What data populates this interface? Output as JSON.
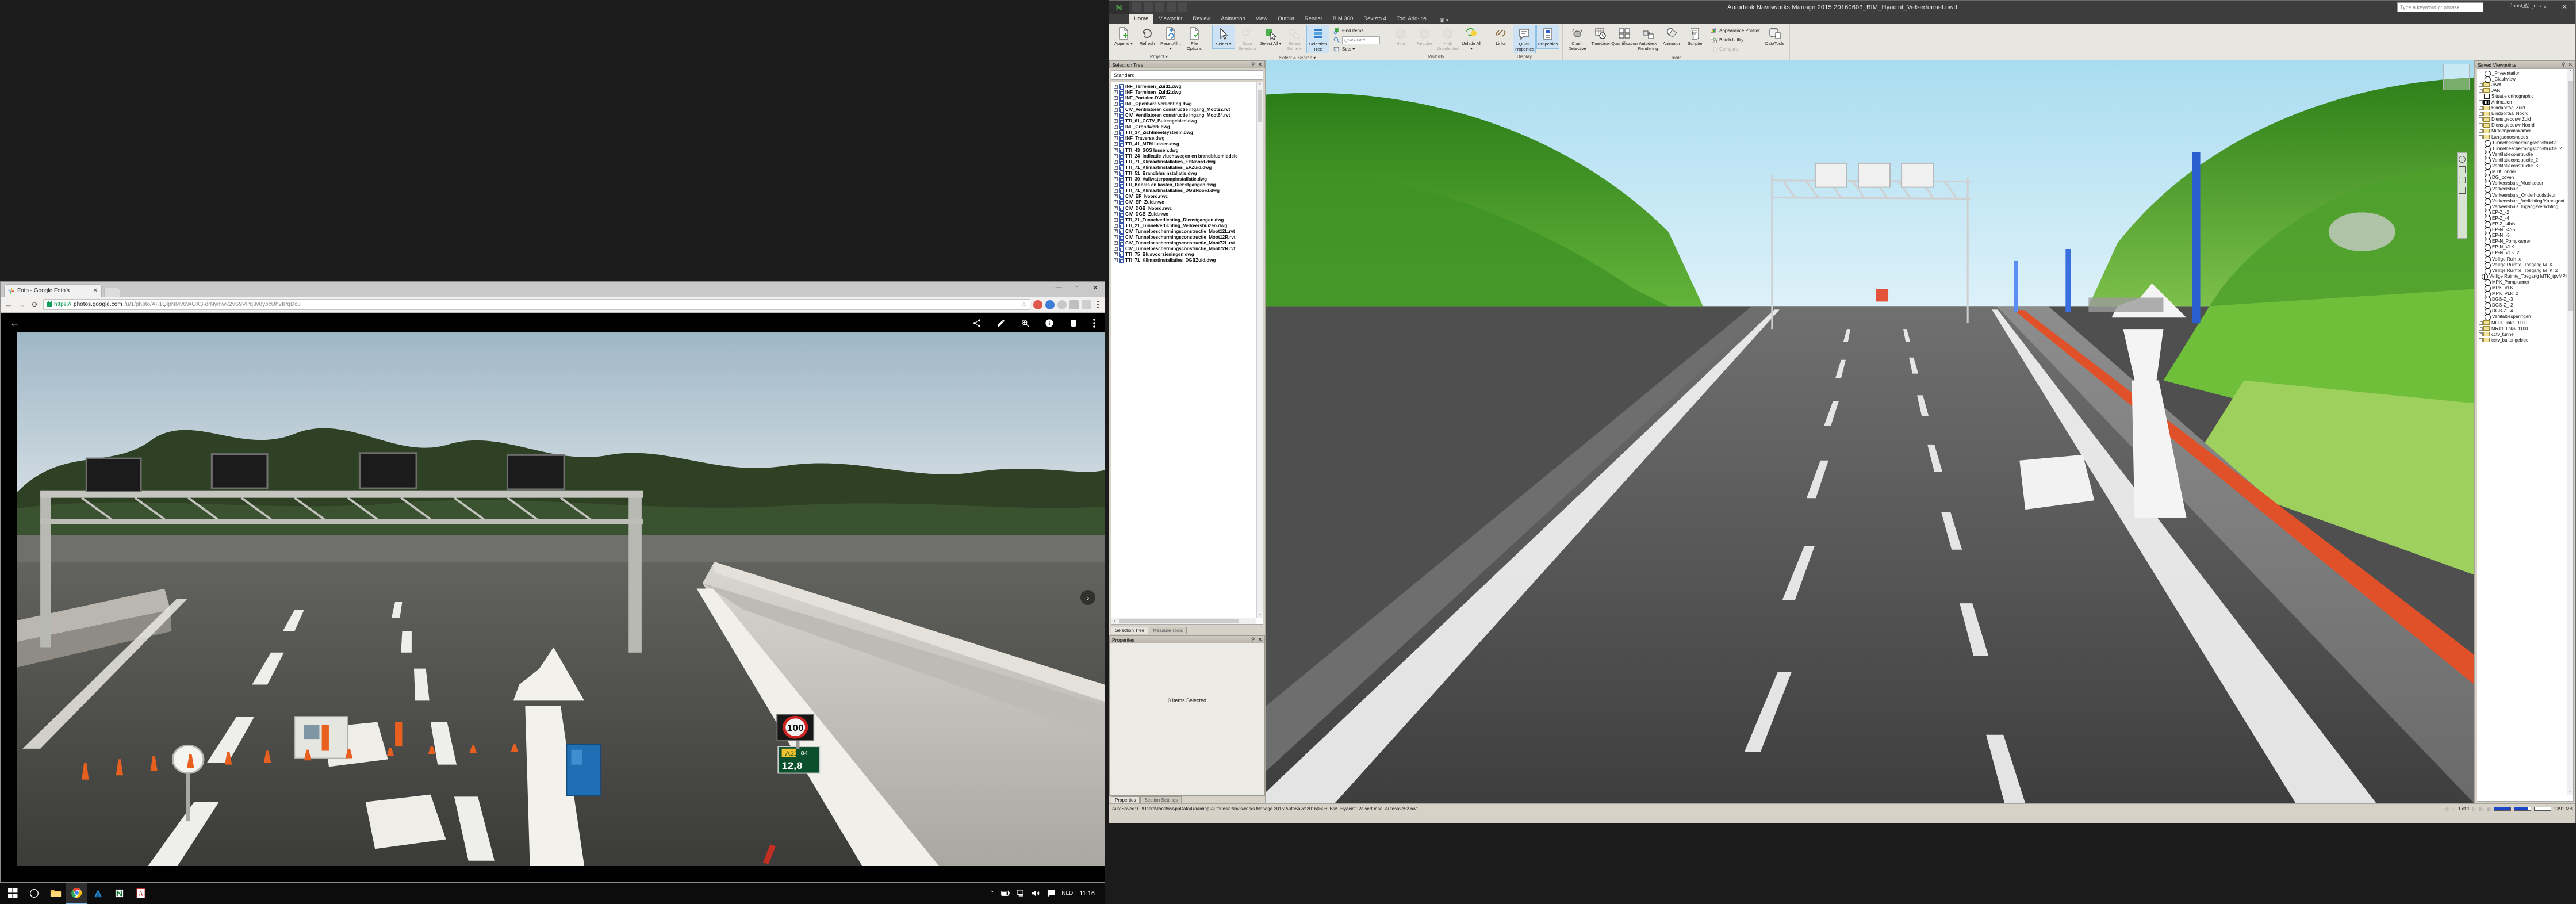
{
  "navisworks": {
    "title": "Autodesk Navisworks Manage 2015    20160603_BIM_Hyacint_Velsertunnel.nwd",
    "search_placeholder": "Type a keyword or phrase",
    "account": "Joost Weijers",
    "window_buttons": [
      "—",
      "▫",
      "✕"
    ],
    "tabs": [
      {
        "label": "Home",
        "active": true
      },
      {
        "label": "Viewpoint",
        "active": false
      },
      {
        "label": "Review",
        "active": false
      },
      {
        "label": "Animation",
        "active": false
      },
      {
        "label": "View",
        "active": false
      },
      {
        "label": "Output",
        "active": false
      },
      {
        "label": "Render",
        "active": false
      },
      {
        "label": "BIM 360",
        "active": false
      },
      {
        "label": "Revizto 4",
        "active": false
      },
      {
        "label": "Tool Add-ins",
        "active": false
      }
    ],
    "ribbon_groups": [
      {
        "name": "Project",
        "buttons": [
          {
            "label": "Append",
            "icon": "append-icon",
            "state": "normal",
            "dropdown": true
          },
          {
            "label": "Refresh",
            "icon": "refresh-icon",
            "state": "normal"
          },
          {
            "label": "Reset All...",
            "icon": "reset-all-icon",
            "state": "normal",
            "dropdown": true
          },
          {
            "label": "File Options",
            "icon": "file-options-icon",
            "state": "normal"
          }
        ]
      },
      {
        "name": "Select & Search",
        "buttons": [
          {
            "label": "Select",
            "icon": "cursor-icon",
            "state": "selected",
            "dropdown": true
          },
          {
            "label": "Save Selection",
            "icon": "save-selection-icon",
            "state": "disabled"
          },
          {
            "label": "Select All",
            "icon": "select-all-icon",
            "state": "normal",
            "dropdown": true
          },
          {
            "label": "Select Same",
            "icon": "select-same-icon",
            "state": "disabled",
            "dropdown": true
          },
          {
            "label": "Selection Tree",
            "icon": "selection-tree-icon",
            "state": "selected"
          }
        ],
        "small_items": [
          {
            "label": "Find Items",
            "icon": "find-items-icon"
          },
          {
            "label": "Quick Find",
            "icon": "quick-find-icon",
            "is_input": true
          },
          {
            "label": "Sets",
            "icon": "sets-icon",
            "dropdown": true
          }
        ]
      },
      {
        "name": "Visibility",
        "buttons": [
          {
            "label": "Hide",
            "icon": "hide-icon",
            "state": "disabled"
          },
          {
            "label": "Require",
            "icon": "require-icon",
            "state": "disabled"
          },
          {
            "label": "Hide Unselected",
            "icon": "hide-unselected-icon",
            "state": "disabled"
          },
          {
            "label": "Unhide All",
            "icon": "unhide-all-icon",
            "state": "normal",
            "dropdown": true
          }
        ]
      },
      {
        "name": "Display",
        "buttons": [
          {
            "label": "Links",
            "icon": "links-icon",
            "state": "normal"
          },
          {
            "label": "Quick Properties",
            "icon": "quick-properties-icon",
            "state": "selected"
          },
          {
            "label": "Properties",
            "icon": "properties-icon",
            "state": "selected"
          }
        ]
      },
      {
        "name": "Tools",
        "buttons": [
          {
            "label": "Clash Detective",
            "icon": "clash-detective-icon",
            "state": "normal"
          },
          {
            "label": "TimeLiner",
            "icon": "timeliner-icon",
            "state": "normal"
          },
          {
            "label": "Quantification",
            "icon": "quantification-icon",
            "state": "normal"
          },
          {
            "label": "Autodesk Rendering",
            "icon": "autodesk-rendering-icon",
            "state": "normal"
          },
          {
            "label": "Animator",
            "icon": "animator-icon",
            "state": "normal"
          },
          {
            "label": "Scripter",
            "icon": "scripter-icon",
            "state": "normal"
          }
        ],
        "small_items": [
          {
            "label": "Appearance Profiler",
            "icon": "appearance-profiler-icon"
          },
          {
            "label": "Batch Utility",
            "icon": "batch-utility-icon"
          },
          {
            "label": "Compare",
            "icon": "compare-icon",
            "disabled": true
          }
        ],
        "extra_buttons": [
          {
            "label": "DataTools",
            "icon": "datatools-icon",
            "state": "normal"
          }
        ]
      }
    ],
    "selection_tree": {
      "title": "Selection Tree",
      "standard_value": "Standard",
      "items": [
        "INF_Terreinen_Zuid1.dwg",
        "INF_Terreinen_Zuid2.dwg",
        "INF_Portalen.DWG",
        "INF_Openbare verlichting.dwg",
        "CIV_Ventilatoren constructie ingang_Moot22.rvt",
        "CIV_Ventilatoren constructie ingang_Moot64.rvt",
        "TTI_61_CCTV_Buitengebied.dwg",
        "INF_Grondwerk.dwg",
        "TTI_37_Zichtmeetsysteem.dwg",
        "INF_Traverse.dwg",
        "TTI_41_MTM lussen.dwg",
        "TTI_43_SOS lussen.dwg",
        "TTI_24_Indicatie vluchtwegen en brandblusmiddele",
        "TTI_71_Klimaatinstallaties_EPNoord.dwg",
        "TTI_71_Klimaatinstallaties_EPZuid.dwg",
        "TTI_51_Brandblusinstallatie.dwg",
        "TTI_30_Vuilwaterpompinstallatie.dwg",
        "TTI_Kabels en kasten_Dienstgangen.dwg",
        "TTI_71_Klimaatinstallaties_DGBNoord.dwg",
        "CIV_EP_Noord.nwc",
        "CIV_EP_Zuid.nwc",
        "CIV_DGB_Noord.nwc",
        "CIV_DGB_Zuid.nwc",
        "TTI_21_Tunnelverlichting_Dienstgangen.dwg",
        "TTI_21_Tunnelverlichting_Verkeersbuizen.dwg",
        "CIV_Tunnelbeschermingsconstructie_Moot12L.rvt",
        "CIV_Tunnelbeschermingsconstructie_Moot12R.rvt",
        "CIV_Tunnelbeschermingsconstructie_Moot72L.rvt",
        "CIV_Tunnelbeschermingsconstructie_Moot72R.rvt",
        "TTI_75_Blusvoorzieningen.dwg",
        "TTI_71_Klimaatinstallaties_DGBZuid.dwg"
      ],
      "dock_tabs": [
        {
          "label": "Selection Tree",
          "active": true
        },
        {
          "label": "Measure Tools",
          "active": false
        }
      ]
    },
    "properties": {
      "title": "Properties",
      "empty_message": "0 Items Selected",
      "dock_tabs": [
        {
          "label": "Properties",
          "active": true
        },
        {
          "label": "Section Settings",
          "active": false
        }
      ]
    },
    "saved_viewpoints": {
      "title": "Saved Viewpoints",
      "items": [
        {
          "label": "_Presentation",
          "icon": "camera-icon",
          "expandable": false
        },
        {
          "label": "_Clashview",
          "icon": "camera-icon",
          "expandable": false
        },
        {
          "label": "JAW",
          "icon": "folder-icon",
          "expandable": true
        },
        {
          "label": "JAN",
          "icon": "folder-icon",
          "expandable": true
        },
        {
          "label": "Situatie orthographic",
          "icon": "cube-icon",
          "expandable": false
        },
        {
          "label": "Animation",
          "icon": "film-icon",
          "expandable": true
        },
        {
          "label": "Eindportaal Zuid",
          "icon": "folder-icon",
          "expandable": true
        },
        {
          "label": "Eindportaal Noord",
          "icon": "folder-icon",
          "expandable": true
        },
        {
          "label": "Dienstgebouw Zuid",
          "icon": "folder-icon",
          "expandable": true
        },
        {
          "label": "Dienstgebouw Noord",
          "icon": "folder-icon",
          "expandable": true
        },
        {
          "label": "Middenpompkamer",
          "icon": "folder-icon",
          "expandable": true
        },
        {
          "label": "Langsdoorsnedes",
          "icon": "folder-icon",
          "expandable": true
        },
        {
          "label": "Tunnelbeschermingsconstructie",
          "icon": "camera-icon",
          "expandable": false
        },
        {
          "label": "Tunnelbeschermingsconstructie_2",
          "icon": "camera-icon",
          "expandable": false
        },
        {
          "label": "Ventilatieconstructie",
          "icon": "camera-icon",
          "expandable": false
        },
        {
          "label": "Ventilatieconstructie_2",
          "icon": "camera-icon",
          "expandable": false
        },
        {
          "label": "Ventilatieconstructie_3",
          "icon": "camera-icon",
          "expandable": false
        },
        {
          "label": "MTK_onder",
          "icon": "camera-icon",
          "expandable": false
        },
        {
          "label": "DG_boven",
          "icon": "camera-icon",
          "expandable": false
        },
        {
          "label": "Verkeersbuis_Vluchtdeur",
          "icon": "camera-icon",
          "expandable": false
        },
        {
          "label": "Verkeersbuis",
          "icon": "camera-icon",
          "expandable": false
        },
        {
          "label": "Verkeersbuis_Onderhoudsdeur",
          "icon": "camera-icon",
          "expandable": false
        },
        {
          "label": "Verkeersbuis_Verlichting/Kabelgoot",
          "icon": "camera-icon",
          "expandable": false
        },
        {
          "label": "Verkeersbuis_Ingangsverlichting",
          "icon": "camera-icon",
          "expandable": false
        },
        {
          "label": "EP-Z_-2",
          "icon": "camera-icon",
          "expandable": false
        },
        {
          "label": "EP-Z_-4",
          "icon": "camera-icon",
          "expandable": false
        },
        {
          "label": "EP-Z_-4bis",
          "icon": "camera-icon",
          "expandable": false
        },
        {
          "label": "EP-N_-4/-5",
          "icon": "camera-icon",
          "expandable": false
        },
        {
          "label": "EP-N_-5",
          "icon": "camera-icon",
          "expandable": false
        },
        {
          "label": "EP-N_Pompkamer",
          "icon": "camera-icon",
          "expandable": false
        },
        {
          "label": "EP-N_VLK",
          "icon": "camera-icon",
          "expandable": false
        },
        {
          "label": "EP-N_VLK_2",
          "icon": "camera-icon",
          "expandable": false
        },
        {
          "label": "Veilige Ruimte",
          "icon": "camera-icon",
          "expandable": false
        },
        {
          "label": "Veilige Ruimte_Toegang MTK",
          "icon": "camera-icon",
          "expandable": false
        },
        {
          "label": "Veilige Ruimte_Toegang MTK_2",
          "icon": "camera-icon",
          "expandable": false
        },
        {
          "label": "Veilige Ruimte_Toegang MTK_tpvMPI",
          "icon": "camera-icon",
          "expandable": false
        },
        {
          "label": "MPK_Pompkamer",
          "icon": "camera-icon",
          "expandable": false
        },
        {
          "label": "MPK_VLK",
          "icon": "camera-icon",
          "expandable": false
        },
        {
          "label": "MPK_VLK_2",
          "icon": "camera-icon",
          "expandable": false
        },
        {
          "label": "DGB-Z_-3",
          "icon": "camera-icon",
          "expandable": false
        },
        {
          "label": "DGB-Z_-2",
          "icon": "camera-icon",
          "expandable": false
        },
        {
          "label": "DGB-Z_-4",
          "icon": "camera-icon",
          "expandable": false
        },
        {
          "label": "Venitaltiesparingen",
          "icon": "camera-icon",
          "expandable": false
        },
        {
          "label": "ML01_links_1100",
          "icon": "folder-icon",
          "expandable": true
        },
        {
          "label": "MR01_links_1100",
          "icon": "folder-icon",
          "expandable": true
        },
        {
          "label": "cctv_tunnel",
          "icon": "folder-icon",
          "expandable": true
        },
        {
          "label": "cctv_buitengebied",
          "icon": "folder-icon",
          "expandable": true
        }
      ]
    },
    "status_bar": {
      "autosave_text": "AutoSaved: C:\\Users\\Joostw\\AppData\\Roaming\\Autodesk Navisworks Manage 2015\\AutoSave\\20160603_BIM_Hyacint_Velsertunnel.Autosave52.nwf",
      "page_indicator": "1 of 1",
      "memory": "2391 MB",
      "progress_bars": [
        100,
        85,
        0
      ]
    }
  },
  "chrome": {
    "tab": {
      "title": "Foto - Google Foto's",
      "close_label": "✕"
    },
    "window_buttons": [
      "—",
      "▫",
      "✕"
    ],
    "nav": {
      "back": "←",
      "forward": "→",
      "reload": "⟳"
    },
    "url": {
      "scheme": "https://",
      "domain": "photos.google.com",
      "path": "/u/1/photo/AF1QipNMv6WQX3-drNymwk2vS9VPq3v8yocUh9IPqDc8",
      "full": "https://photos.google.com/u/1/photo/AF1QipNMv6WQX3-drNymwk2vS9VPq3v8yocUh9IPqDc8"
    },
    "toolbar_icons": [
      "star-icon",
      "extension-icon",
      "profile-icon",
      "cast-icon",
      "apps-icon",
      "menu-icon"
    ],
    "photos_app": {
      "back_label": "←",
      "tools": [
        "share-icon",
        "edit-icon",
        "zoom-icon",
        "info-icon",
        "delete-icon",
        "more-icon"
      ],
      "next_label": "›"
    },
    "photo_content": {
      "speed_sign": "100",
      "gantry_sign_left": "A22",
      "gantry_sign_right": "84",
      "gantry_distance": "12,8"
    }
  },
  "taskbar": {
    "start_label": "⊞",
    "apps": [
      {
        "name": "start-icon"
      },
      {
        "name": "cortana-icon"
      },
      {
        "name": "file-explorer-icon"
      },
      {
        "name": "chrome-icon",
        "active": true
      },
      {
        "name": "autocad-icon"
      },
      {
        "name": "navisworks-icon"
      },
      {
        "name": "acrobat-icon"
      }
    ],
    "tray": [
      "chevron-up-icon",
      "battery-icon",
      "network-icon",
      "volume-icon",
      "action-center-icon"
    ],
    "language": "NLD",
    "time": "11:16"
  }
}
